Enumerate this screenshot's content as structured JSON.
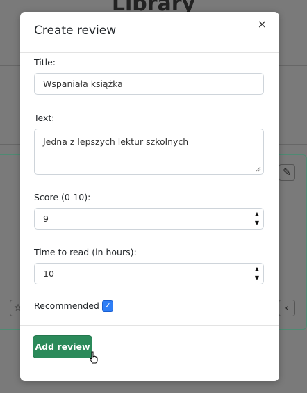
{
  "background": {
    "page_title": "Library"
  },
  "modal": {
    "title": "Create review",
    "close_label": "×",
    "title_field": {
      "label": "Title:",
      "value": "Wspaniała książka"
    },
    "text_field": {
      "label": "Text:",
      "value": "Jedna z lepszych lektur szkolnych"
    },
    "score_field": {
      "label": "Score (0-10):",
      "value": "9"
    },
    "time_field": {
      "label": "Time to read (in hours):",
      "value": "10"
    },
    "recommended": {
      "label": "Recommended",
      "checked": true,
      "check_glyph": "✓"
    },
    "submit_label": "Add review"
  },
  "colors": {
    "primary_button": "#2b8a5a",
    "checkbox": "#2e7ef6"
  }
}
